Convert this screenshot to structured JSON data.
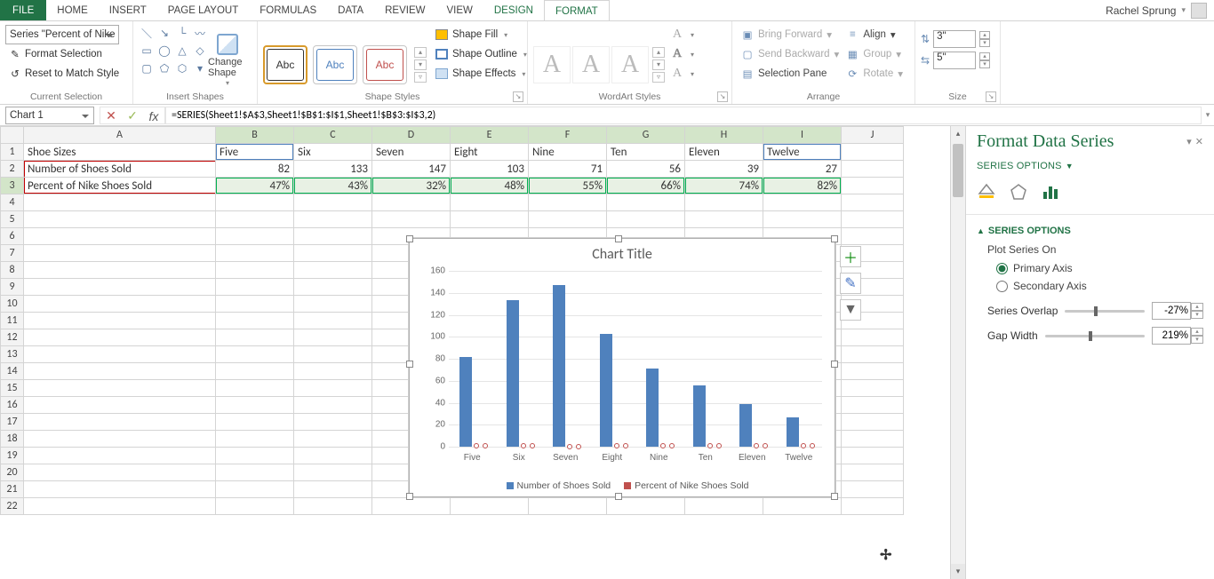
{
  "tabs": {
    "file": "FILE",
    "home": "HOME",
    "insert": "INSERT",
    "pageLayout": "PAGE LAYOUT",
    "formulas": "FORMULAS",
    "data": "DATA",
    "review": "REVIEW",
    "view": "VIEW",
    "design": "DESIGN",
    "format": "FORMAT"
  },
  "user": {
    "name": "Rachel Sprung"
  },
  "ribbon": {
    "currentSelection": {
      "combo": "Series \"Percent of Nike S",
      "formatSelection": "Format Selection",
      "resetToMatch": "Reset to Match Style",
      "label": "Current Selection"
    },
    "insertShapes": {
      "changeShape": "Change Shape",
      "label": "Insert Shapes"
    },
    "shapeStyles": {
      "sample": "Abc",
      "fill": "Shape Fill",
      "outline": "Shape Outline",
      "effects": "Shape Effects",
      "label": "Shape Styles"
    },
    "wordArt": {
      "label": "WordArt Styles"
    },
    "arrange": {
      "bringForward": "Bring Forward",
      "sendBackward": "Send Backward",
      "selectionPane": "Selection Pane",
      "align": "Align",
      "group": "Group",
      "rotate": "Rotate",
      "label": "Arrange"
    },
    "size": {
      "height": "3\"",
      "width": "5\"",
      "label": "Size"
    }
  },
  "formulaBar": {
    "nameBox": "Chart 1",
    "formula": "=SERIES(Sheet1!$A$3,Sheet1!$B$1:$I$1,Sheet1!$B$3:$I$3,2)"
  },
  "columns": [
    "A",
    "B",
    "C",
    "D",
    "E",
    "F",
    "G",
    "H",
    "I",
    "J"
  ],
  "sheet": {
    "A1": "Shoe Sizes",
    "A2": "Number of Shoes Sold",
    "A3": "Percent of Nike Shoes Sold",
    "headers": [
      "Five",
      "Six",
      "Seven",
      "Eight",
      "Nine",
      "Ten",
      "Eleven",
      "Twelve"
    ],
    "row2": [
      82,
      133,
      147,
      103,
      71,
      56,
      39,
      27
    ],
    "row3": [
      "47%",
      "43%",
      "32%",
      "48%",
      "55%",
      "66%",
      "74%",
      "82%"
    ]
  },
  "chart_data": {
    "type": "bar",
    "title": "Chart Title",
    "categories": [
      "Five",
      "Six",
      "Seven",
      "Eight",
      "Nine",
      "Ten",
      "Eleven",
      "Twelve"
    ],
    "series": [
      {
        "name": "Number of Shoes Sold",
        "values": [
          82,
          133,
          147,
          103,
          71,
          56,
          39,
          27
        ],
        "color": "#4f81bd"
      },
      {
        "name": "Percent of Nike Shoes Sold",
        "values": [
          0.47,
          0.43,
          0.32,
          0.48,
          0.55,
          0.66,
          0.74,
          0.82
        ],
        "color": "#c0504d"
      }
    ],
    "ylim": [
      0,
      160
    ],
    "yticks": [
      0,
      20,
      40,
      60,
      80,
      100,
      120,
      140,
      160
    ],
    "legend": [
      "Number of Shoes Sold",
      "Percent of Nike Shoes Sold"
    ]
  },
  "taskPane": {
    "title": "Format Data Series",
    "subtitle": "SERIES OPTIONS",
    "section": "SERIES OPTIONS",
    "plotOn": "Plot Series On",
    "primary": "Primary Axis",
    "secondary": "Secondary Axis",
    "overlapLabel": "Series Overlap",
    "overlap": "-27%",
    "gapLabel": "Gap Width",
    "gap": "219%"
  }
}
